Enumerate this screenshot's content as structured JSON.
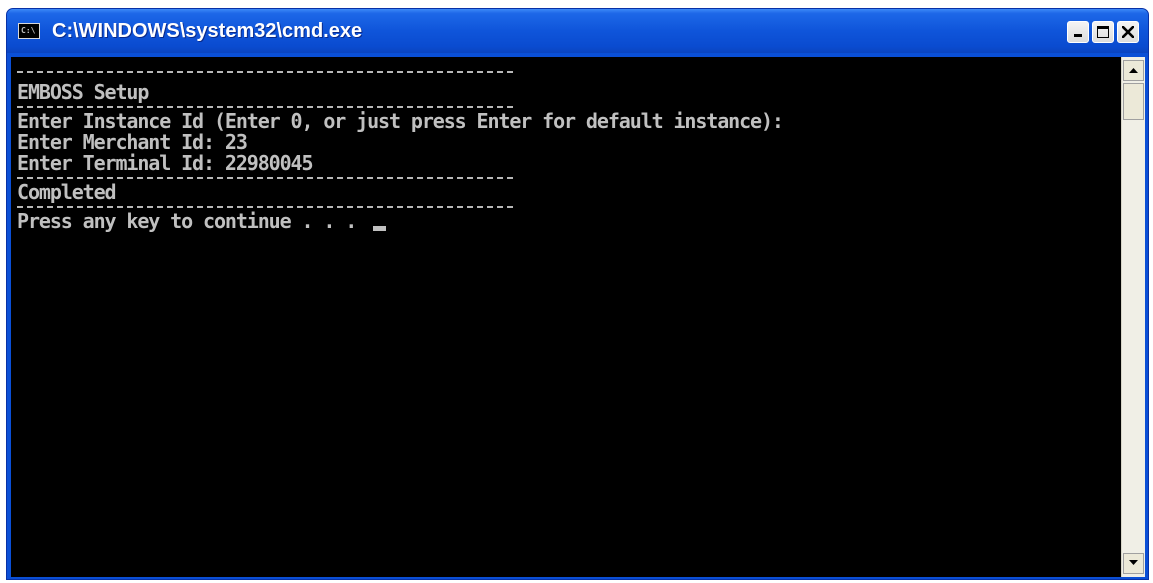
{
  "window": {
    "title": "C:\\WINDOWS\\system32\\cmd.exe",
    "app_icon_text": "C:\\",
    "icon": "cmd-prompt-icon"
  },
  "controls": {
    "minimize": "minimize-icon",
    "maximize": "maximize-icon",
    "close": "close-icon"
  },
  "console": {
    "heading": "EMBOSS Setup",
    "prompt_instance": "Enter Instance Id (Enter 0, or just press Enter for default instance):",
    "prompt_merchant": "Enter Merchant Id: 23",
    "prompt_terminal": "Enter Terminal Id: 22980045",
    "status": "Completed",
    "continue_prompt": "Press any key to continue . . . "
  },
  "colors": {
    "titlebar": "#0a4bd0",
    "console_background": "#000000",
    "console_text": "#c0c0c0"
  }
}
